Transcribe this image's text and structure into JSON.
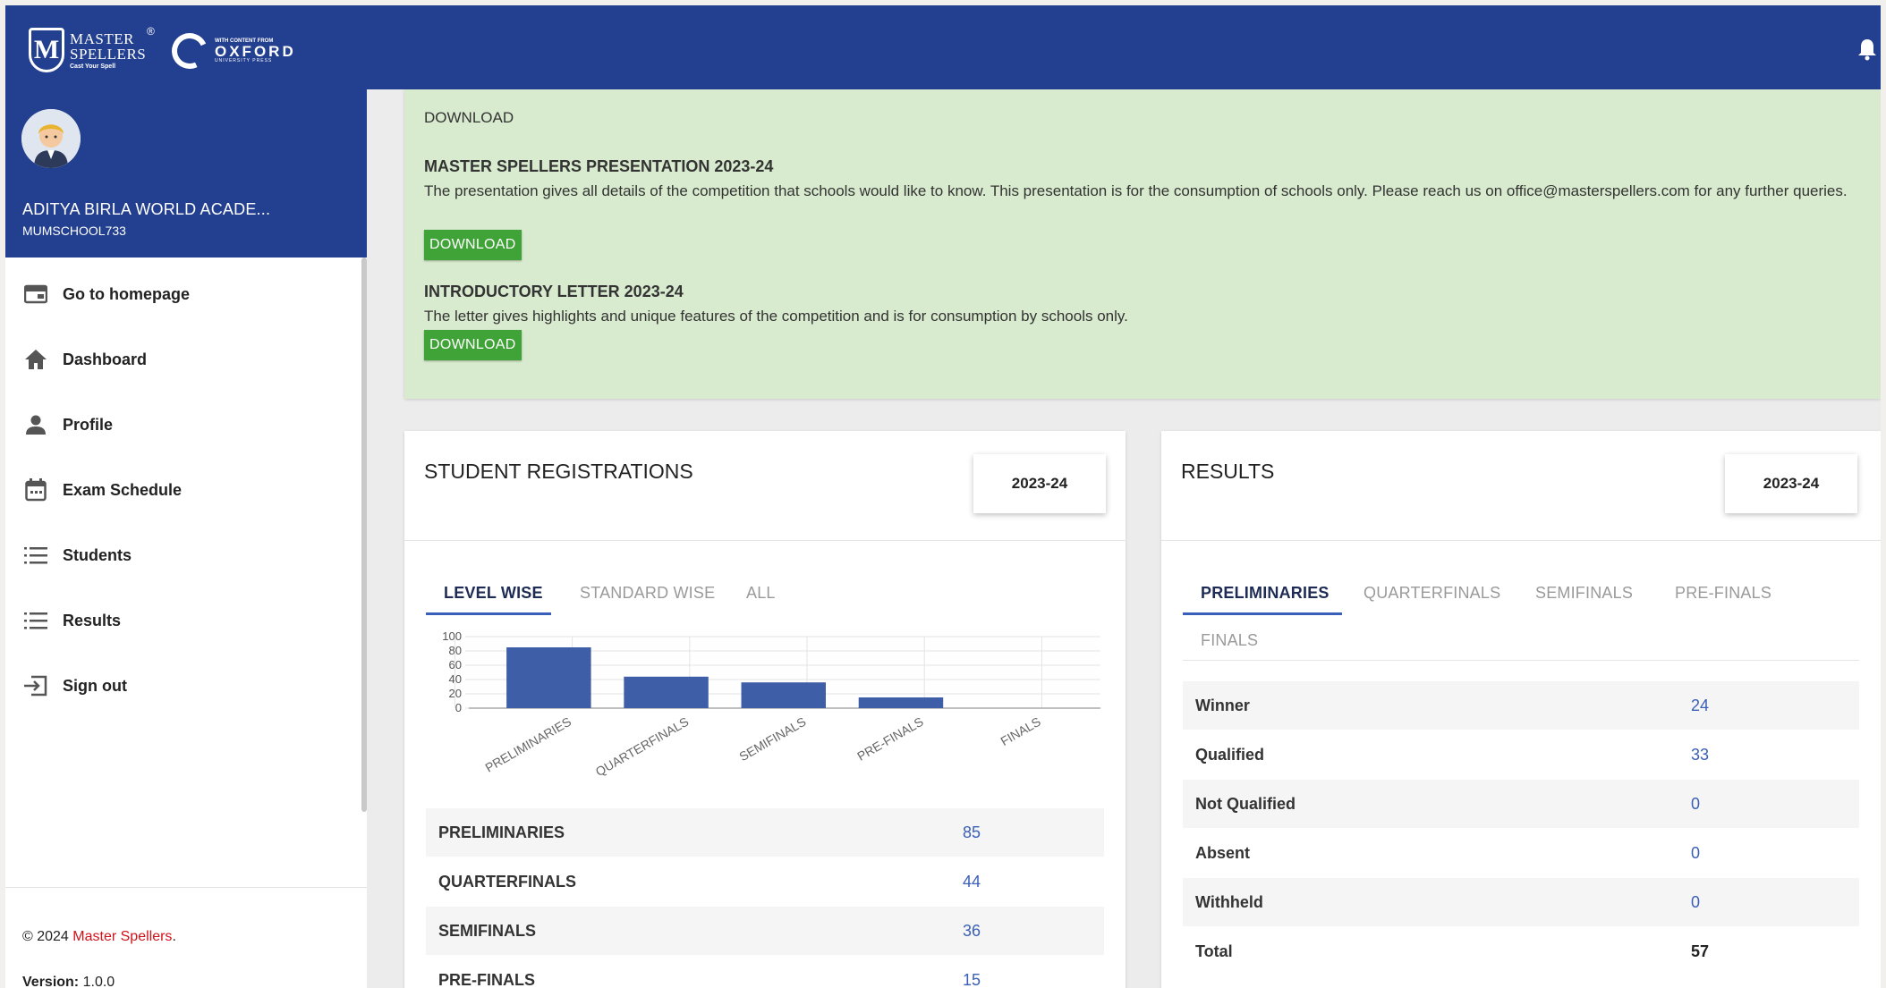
{
  "header": {
    "logo_master": "MASTER",
    "logo_spellers": "SPELLERS",
    "logo_tagline": "Cast Your Spell",
    "logo_oxford_small": "WITH CONTENT FROM",
    "logo_oxford": "OXFORD",
    "logo_oxford_press": "UNIVERSITY PRESS",
    "icons": [
      "shield-logo-icon",
      "oxford-logo-icon",
      "bell-icon"
    ]
  },
  "sidebar": {
    "school_name": "ADITYA BIRLA WORLD ACADE...",
    "school_code": "MUMSCHOOL733",
    "items": [
      {
        "label": "Go to homepage",
        "icon": "homepage-icon"
      },
      {
        "label": "Dashboard",
        "icon": "home-icon"
      },
      {
        "label": "Profile",
        "icon": "person-icon"
      },
      {
        "label": "Exam Schedule",
        "icon": "calendar-icon"
      },
      {
        "label": "Students",
        "icon": "list-icon"
      },
      {
        "label": "Results",
        "icon": "list-icon"
      },
      {
        "label": "Sign out",
        "icon": "sign-out-icon"
      }
    ],
    "copyright_prefix": "© 2024",
    "copyright_brand": "Master Spellers",
    "copyright_suffix": ".",
    "version_label": "Version:",
    "version_value": "1.0.0"
  },
  "downloads": {
    "top_label": "DOWNLOAD",
    "items": [
      {
        "title": "MASTER SPELLERS PRESENTATION 2023-24",
        "text": "The presentation gives all details of the competition that schools would like to know. This presentation is for the consumption of schools only. Please reach us on office@masterspellers.com for any further queries.",
        "button": "DOWNLOAD"
      },
      {
        "title": "INTRODUCTORY LETTER 2023-24",
        "text": "The letter gives highlights and unique features of the competition and is for consumption by schools only.",
        "button": "DOWNLOAD"
      }
    ]
  },
  "registrations": {
    "title": "STUDENT REGISTRATIONS",
    "year": "2023-24",
    "tabs": [
      "LEVEL WISE",
      "STANDARD WISE",
      "ALL"
    ],
    "active_tab": 0,
    "rows": [
      {
        "label": "PRELIMINARIES",
        "value": "85"
      },
      {
        "label": "QUARTERFINALS",
        "value": "44"
      },
      {
        "label": "SEMIFINALS",
        "value": "36"
      },
      {
        "label": "PRE-FINALS",
        "value": "15"
      }
    ]
  },
  "chart_data": {
    "type": "bar",
    "categories": [
      "PRELIMINARIES",
      "QUARTERFINALS",
      "SEMIFINALS",
      "PRE-FINALS",
      "FINALS"
    ],
    "values": [
      85,
      44,
      36,
      15,
      0
    ],
    "yticks": [
      "100",
      "80",
      "60",
      "40",
      "20",
      "0"
    ],
    "ylim": [
      0,
      100
    ],
    "title": "",
    "xlabel": "",
    "ylabel": "",
    "grid": true,
    "bar_color": "#3f5ea8"
  },
  "results": {
    "title": "RESULTS",
    "year": "2023-24",
    "tabs": [
      "PRELIMINARIES",
      "QUARTERFINALS",
      "SEMIFINALS",
      "PRE-FINALS",
      "FINALS"
    ],
    "active_tab": 0,
    "rows": [
      {
        "label": "Winner",
        "value": "24"
      },
      {
        "label": "Qualified",
        "value": "33"
      },
      {
        "label": "Not Qualified",
        "value": "0"
      },
      {
        "label": "Absent",
        "value": "0"
      },
      {
        "label": "Withheld",
        "value": "0"
      },
      {
        "label": "Total",
        "value": "57"
      }
    ]
  },
  "colors": {
    "primary": "#233f8f",
    "download_bg": "#d8ebce",
    "download_button": "#3fa337",
    "brand_red": "#d0121b",
    "link_blue": "#3a5fb8"
  }
}
